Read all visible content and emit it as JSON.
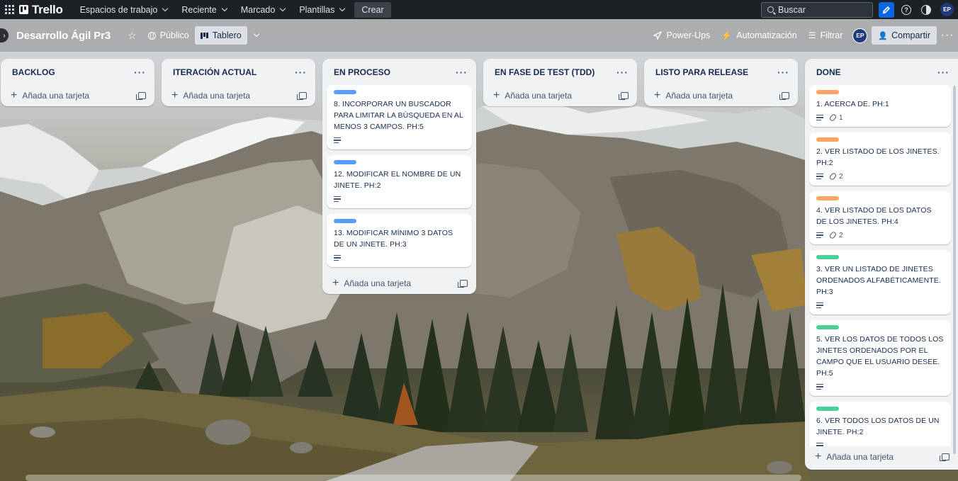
{
  "topnav": {
    "brand": "Trello",
    "items": [
      {
        "label": "Espacios de trabajo"
      },
      {
        "label": "Reciente"
      },
      {
        "label": "Marcado"
      },
      {
        "label": "Plantillas"
      }
    ],
    "create_label": "Crear",
    "search_placeholder": "Buscar",
    "avatar_initials": "EP"
  },
  "board": {
    "title": "Desarrollo Ágil Pr3",
    "visibility_label": "Público",
    "view_label": "Tablero",
    "powerups_label": "Power-Ups",
    "automation_label": "Automatización",
    "filter_label": "Filtrar",
    "avatar_initials": "EP",
    "share_label": "Compartir"
  },
  "add_card_label": "Añada una tarjeta",
  "colors": {
    "label_blue": "#579dff",
    "label_orange": "#fea362",
    "label_green": "#4bce97",
    "nav_bg": "#1d2125",
    "accent": "#0c66e4"
  },
  "lists": {
    "backlog": {
      "title": "BACKLOG"
    },
    "iteracion": {
      "title": "ITERACIÓN ACTUAL"
    },
    "proceso": {
      "title": "EN PROCESO",
      "cards": [
        {
          "title": "8. INCORPORAR UN BUSCADOR PARA LIMITAR LA BÚSQUEDA EN AL MENOS 3 CAMPOS. PH:5",
          "label": "blue"
        },
        {
          "title": "12. MODIFICAR EL NOMBRE DE UN JINETE. PH:2",
          "label": "blue"
        },
        {
          "title": "13. MODIFICAR MÍNIMO 3 DATOS DE UN JINETE. PH:3",
          "label": "blue"
        }
      ]
    },
    "test": {
      "title": "EN FASE DE TEST (TDD)"
    },
    "release": {
      "title": "LISTO PARA RELEASE"
    },
    "done": {
      "title": "DONE",
      "cards": [
        {
          "title": "1. ACERCA DE. PH:1",
          "label": "orange",
          "attachments": "1"
        },
        {
          "title": "2. VER LISTADO DE LOS JINETES. PH:2",
          "label": "orange",
          "attachments": "2"
        },
        {
          "title": "4. VER LISTADO DE LOS DATOS DE LOS JINETES. PH:4",
          "label": "orange",
          "attachments": "2"
        },
        {
          "title": "3. VER UN LISTADO DE JINETES ORDENADOS ALFABÉTICAMENTE. PH:3",
          "label": "green"
        },
        {
          "title": "5. VER LOS DATOS DE TODOS LOS JINETES ORDENADOS POR EL CAMPO QUE EL USUARIO DESEE. PH:5",
          "label": "green"
        },
        {
          "title": "6. VER TODOS LOS DATOS DE UN JINETE. PH:2",
          "label": "green"
        }
      ]
    }
  }
}
